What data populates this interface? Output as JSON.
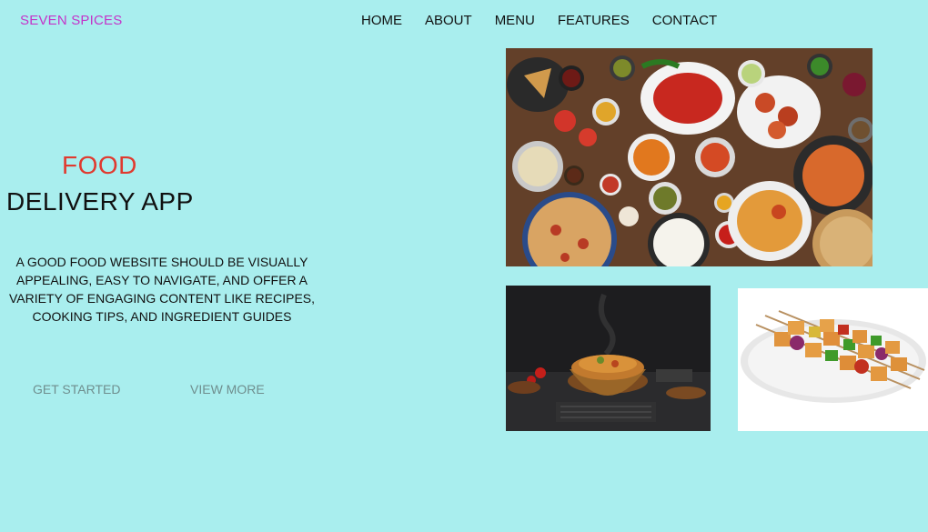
{
  "brand": "SEVEN SPICES",
  "nav": {
    "items": [
      "HOME",
      "ABOUT",
      "MENU",
      "FEATURES",
      "CONTACT"
    ]
  },
  "hero": {
    "title_accent": "FOOD",
    "title_main": "DELIVERY APP",
    "description_lines": [
      "A GOOD FOOD WEBSITE SHOULD BE VISUALLY",
      "APPEALING, EASY TO NAVIGATE, AND OFFER A",
      "VARIETY OF ENGAGING CONTENT LIKE RECIPES,",
      "COOKING TIPS, AND INGREDIENT GUIDES"
    ],
    "primary_button": "GET STARTED",
    "secondary_button": "VIEW MORE"
  },
  "colors": {
    "background": "#a9eeee",
    "brand": "#c434c9",
    "accent": "#e03a2f",
    "button_text": "#6f8e8e"
  },
  "images": {
    "main": "indian-food-spread-photo",
    "secondary_left": "biryani-pot-photo",
    "secondary_right": "paneer-tikka-skewers-photo"
  }
}
